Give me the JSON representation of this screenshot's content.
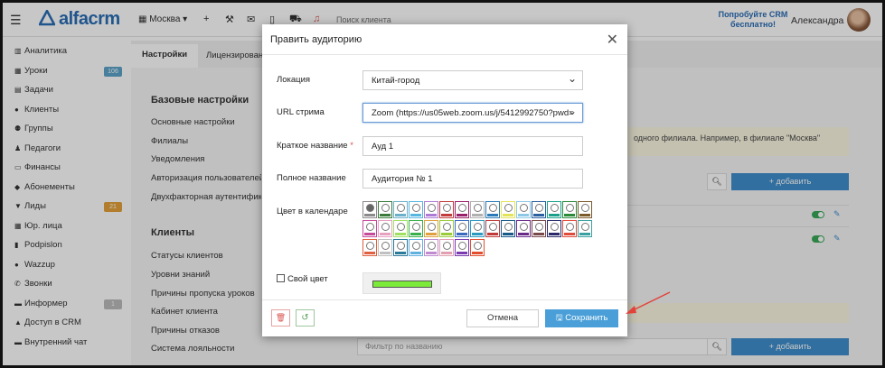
{
  "topbar": {
    "logo": "alfacrm",
    "city": "Москва",
    "search_placeholder": "Поиск клиента",
    "promo": "Попробуйте CRM бесплатно!",
    "user": "Александра"
  },
  "sidebar": {
    "items": [
      {
        "label": "Аналитика",
        "icon": "chart-icon"
      },
      {
        "label": "Уроки",
        "icon": "calendar-icon",
        "badge": "106",
        "badge_color": "#5ba3c9"
      },
      {
        "label": "Задачи",
        "icon": "task-icon"
      },
      {
        "label": "Клиенты",
        "icon": "user-icon"
      },
      {
        "label": "Группы",
        "icon": "users-icon"
      },
      {
        "label": "Педагоги",
        "icon": "teacher-icon"
      },
      {
        "label": "Финансы",
        "icon": "money-icon"
      },
      {
        "label": "Абонементы",
        "icon": "tag-icon"
      },
      {
        "label": "Лиды",
        "icon": "funnel-icon",
        "badge": "21",
        "badge_color": "#e5a23a"
      },
      {
        "label": "Юр. лица",
        "icon": "building-icon"
      },
      {
        "label": "Podpislon",
        "icon": "doc-icon"
      },
      {
        "label": "Wazzup",
        "icon": "whatsapp-icon"
      },
      {
        "label": "Звонки",
        "icon": "phone-icon"
      },
      {
        "label": "Информер",
        "icon": "info-icon",
        "badge": "1",
        "badge_color": "#bbbbbb"
      },
      {
        "label": "Доступ в CRM",
        "icon": "lock-icon"
      },
      {
        "label": "Внутренний чат",
        "icon": "chat-icon"
      }
    ]
  },
  "tabs": {
    "settings": "Настройки",
    "license": "Лицензирован"
  },
  "settings": {
    "basic_header": "Базовые настройки",
    "basic": [
      "Основные настройки",
      "Филиалы",
      "Уведомления",
      "Авторизация пользователей",
      "Двухфакторная аутентификация"
    ],
    "clients_header": "Клиенты",
    "clients": [
      "Статусы клиентов",
      "Уровни знаний",
      "Причины пропуска уроков",
      "Кабинет клиента",
      "Причины отказов",
      "Система лояльности"
    ]
  },
  "right": {
    "notice": "одного филиала. Например, в филиале \"Москва\"",
    "add_label": "+ добавить",
    "filter_placeholder": "Фильтр по названию"
  },
  "modal": {
    "title": "Править аудиторию",
    "location_label": "Локация",
    "location_value": "Китай-город",
    "url_label": "URL стрима",
    "url_value": "Zoom (https://us05web.zoom.us/j/5412992750?pwd=",
    "short_label": "Краткое название",
    "short_value": "Ауд 1",
    "full_label": "Полное название",
    "full_value": "Аудитория № 1",
    "color_label": "Цвет в календаре",
    "own_color_label": "Свой цвет",
    "own_color": "#7bea38",
    "cancel": "Отмена",
    "save": "Сохранить",
    "swatches": [
      "#8a8a8a",
      "#3a7a3a",
      "#6ab0c8",
      "#56b6e0",
      "#ad7bd6",
      "#c23a3a",
      "#9a1f6a",
      "#b0b0b0",
      "#2a7ab8",
      "#e3e35a",
      "#8cc8e6",
      "#2a5fa0",
      "#1aa08a",
      "#2a8a3a",
      "#7a5a2a",
      "#c64a9a",
      "#e6a0c0",
      "#a0e060",
      "#3ab04a",
      "#e0a040",
      "#9acc3a",
      "#3a6ac0",
      "#2a9ac0",
      "#c03a3a",
      "#1a5a8a",
      "#6a2a8a",
      "#7a4a4a",
      "#2a2a6a",
      "#e04a3a",
      "#3aa0a0",
      "#e06040",
      "#c0c0c0",
      "#2a7a9a",
      "#60b0e0",
      "#c08ad0",
      "#e0a0b0",
      "#7a3ab0",
      "#e05030"
    ]
  }
}
